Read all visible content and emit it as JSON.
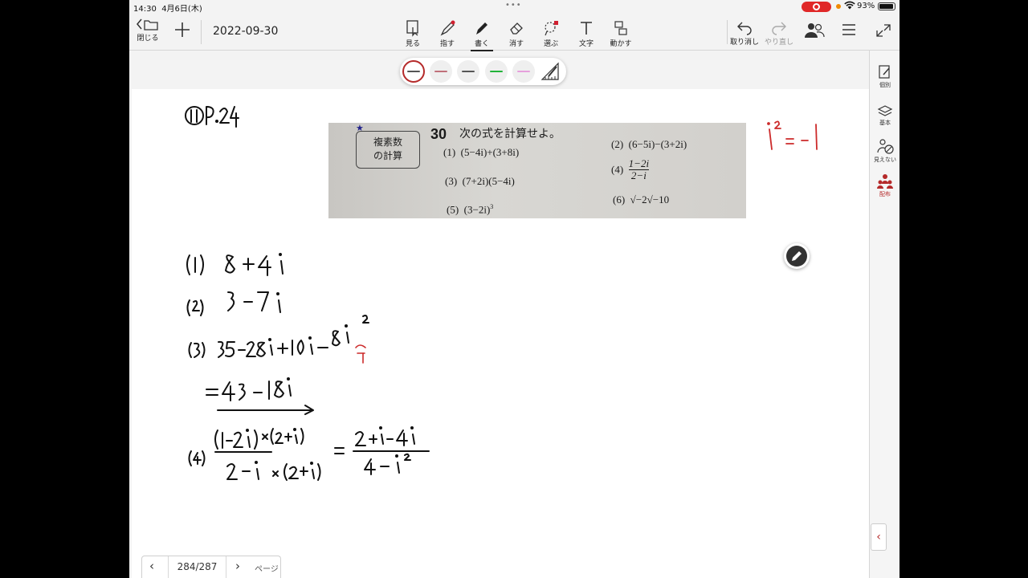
{
  "status_bar": {
    "time": "14:30",
    "date": "4月6日(木)",
    "battery_pct": "93%"
  },
  "toolbar": {
    "close_label": "閉じる",
    "document_title": "2022-09-30",
    "tools": [
      {
        "id": "view",
        "label": "見る"
      },
      {
        "id": "point",
        "label": "指す"
      },
      {
        "id": "write",
        "label": "書く"
      },
      {
        "id": "erase",
        "label": "消す"
      },
      {
        "id": "select",
        "label": "選ぶ"
      },
      {
        "id": "text",
        "label": "文字"
      },
      {
        "id": "move",
        "label": "動かす"
      }
    ],
    "undo_label": "取り消し",
    "redo_label": "やり直し",
    "active_tool": "write"
  },
  "palette": {
    "colors": [
      "#555555",
      "#c0707a",
      "#555555",
      "#22b33a",
      "#e6a0dc"
    ],
    "selected_index": 0
  },
  "problem": {
    "number": "30",
    "category": [
      "複素数",
      "の計算"
    ],
    "instruction": "次の式を計算せよ。",
    "items": [
      {
        "label": "(1)",
        "expr": "(5−4i)+(3+8i)"
      },
      {
        "label": "(2)",
        "expr": "(6−5i)−(3+2i)"
      },
      {
        "label": "(3)",
        "expr": "(7+2i)(5−4i)"
      },
      {
        "label": "(4)",
        "num": "1−2i",
        "den": "2−i"
      },
      {
        "label": "(5)",
        "expr": "(3−2i)",
        "exp": "3"
      },
      {
        "label": "(6)",
        "expr": "√−2√−10"
      }
    ]
  },
  "handwritten": {
    "header": "⑪P.24",
    "identity": "i² = −1",
    "answers": [
      {
        "label": "(1)",
        "text": "8+4i"
      },
      {
        "label": "(2)",
        "text": "3−7i"
      },
      {
        "label": "(3)",
        "text": "35−28i+10i−8i²"
      },
      {
        "label": "",
        "text": "=43−18i"
      },
      {
        "label": "(4)",
        "text": "(1−2i)×(2+i) / (2−i)×(2+i) = 2+i−4i / 4−i²"
      }
    ]
  },
  "pagination": {
    "current": "284/287",
    "suffix": "ページ"
  },
  "side_panel": [
    {
      "id": "individual",
      "label": "個別"
    },
    {
      "id": "basic",
      "label": "基本"
    },
    {
      "id": "hidden",
      "label": "見えない"
    },
    {
      "id": "distribute",
      "label": "配布"
    }
  ]
}
